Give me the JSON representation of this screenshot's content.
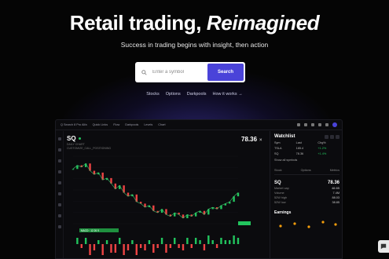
{
  "hero": {
    "title_plain": "Retail trading, ",
    "title_em": "Reimagined",
    "subtitle": "Success in trading begins with insight, then action"
  },
  "search": {
    "placeholder": "Enter a symbol",
    "button": "Search"
  },
  "links": [
    "Stocks",
    "Options",
    "Darkpools",
    "How it works →"
  ],
  "app": {
    "topbar": [
      "Q Search 8 Pro Alfa",
      "Quick Links",
      "Flow",
      "Darkpools",
      "Levels",
      "Chart"
    ],
    "ticker": "SQ",
    "meta_line1": "DAILY CHART",
    "meta_line2": "CUSTOMIZE_CALL_POSITIONING",
    "price": "78.36",
    "close_glyph": "×",
    "macd_label": "MACD · 12 26 9",
    "panel": {
      "watchlist_title": "Watchlist",
      "cols": [
        "Sym",
        "Last",
        "Chg%"
      ],
      "rows": [
        {
          "sym": "TSLA",
          "last": "185.4",
          "chg": "+1.2%"
        },
        {
          "sym": "SQ",
          "last": "78.36",
          "chg": "+1.4%"
        }
      ],
      "show_all": "Show all symbols",
      "tabs": [
        "Stock",
        "Options",
        "Metrics"
      ],
      "symbol": "SQ",
      "symbol_price": "78.36",
      "stats": [
        {
          "k": "Market cap",
          "v": "48.6B"
        },
        {
          "k": "Volume",
          "v": "7.4M"
        },
        {
          "k": "52W high",
          "v": "88.03"
        },
        {
          "k": "52W low",
          "v": "38.85"
        }
      ],
      "earnings": "Earnings"
    }
  },
  "chart_data": {
    "type": "line",
    "x": [
      0,
      1,
      2,
      3,
      4,
      5,
      6,
      7,
      8,
      9,
      10,
      11,
      12,
      13,
      14,
      15,
      16,
      17,
      18,
      19,
      20,
      21,
      22,
      23,
      24,
      25,
      26,
      27,
      28,
      29,
      30,
      31,
      32,
      33,
      34,
      35,
      36,
      37,
      38,
      39
    ],
    "values": [
      85,
      87,
      86,
      88,
      84,
      82,
      83,
      79,
      80,
      77,
      74,
      76,
      72,
      70,
      71,
      67,
      66,
      64,
      65,
      62,
      61,
      63,
      60,
      59,
      61,
      60,
      58,
      60,
      59,
      61,
      62,
      60,
      63,
      64,
      63,
      65,
      66,
      67,
      70,
      72
    ],
    "ylim": [
      55,
      92
    ]
  }
}
